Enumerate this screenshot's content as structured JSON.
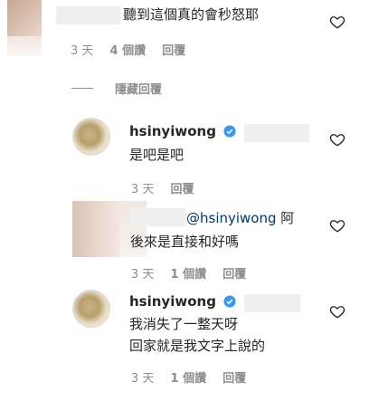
{
  "comment1": {
    "text": "聽到這個真的會秒怒耶",
    "time": "3 天",
    "likes": "4 個讚",
    "reply": "回覆"
  },
  "hide_replies": "隱藏回覆",
  "reply1": {
    "username": "hsinyiwong",
    "text": "是吧是吧",
    "time": "3 天",
    "reply": "回覆"
  },
  "reply2": {
    "mention": "@hsinyiwong",
    "line1_suffix": "阿",
    "line2": "後來是直接和好嗎",
    "time": "3 天",
    "likes": "1 個讚",
    "reply": "回覆"
  },
  "reply3": {
    "username": "hsinyiwong",
    "line1": "我消失了一整天呀",
    "line2": "回家就是我文字上說的",
    "time": "3 天",
    "likes": "1 個讚",
    "reply": "回覆"
  },
  "colors": {
    "verified": "#3897f0",
    "mention": "#00376b",
    "meta": "#8e8e8e"
  }
}
